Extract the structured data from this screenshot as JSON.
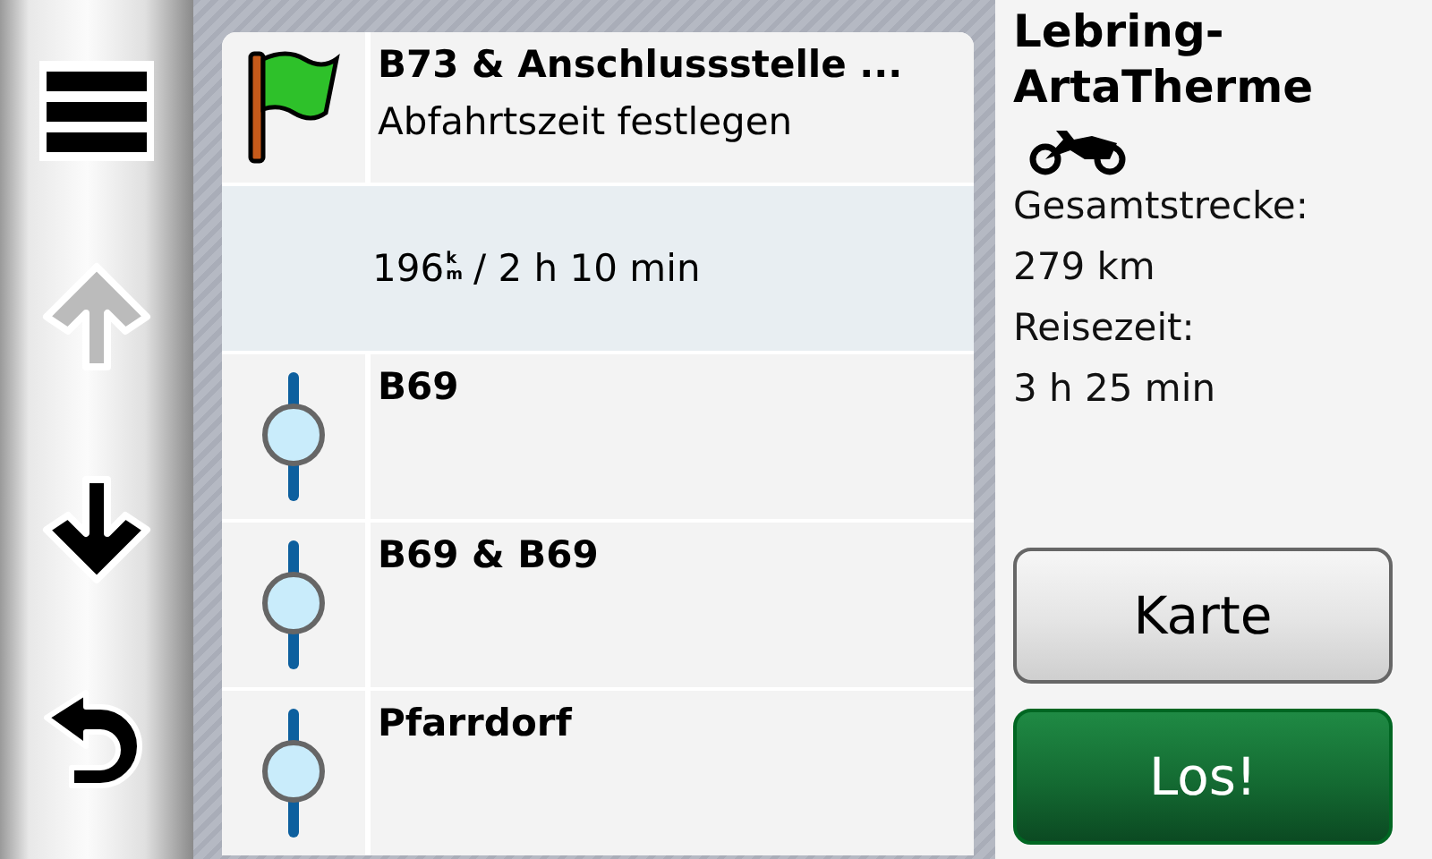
{
  "side_buttons": [
    {
      "kind": "menu",
      "disabled": false
    },
    {
      "kind": "up",
      "disabled": true
    },
    {
      "kind": "down",
      "disabled": false
    },
    {
      "kind": "back",
      "disabled": false
    }
  ],
  "route": [
    {
      "kind": "start",
      "title": "B73 & Anschlussstelle ...",
      "subtitle": "Abfahrtszeit festlegen"
    },
    {
      "kind": "summary",
      "distance": "196",
      "unit_top": "k",
      "unit_bottom": "m",
      "duration": "/ 2 h 10 min"
    },
    {
      "kind": "waypoint",
      "title": "B69"
    },
    {
      "kind": "waypoint",
      "title": "B69 & B69"
    },
    {
      "kind": "waypoint",
      "title": "Pfarrdorf"
    }
  ],
  "destination": {
    "title": "Lebring-ArtaTherme",
    "total_label": "Gesamtstrecke:",
    "total": "279 km",
    "time_label": "Reisezeit:",
    "time": "3 h 25 min"
  },
  "buttons": [
    {
      "kind": "secondary",
      "label": "Karte"
    },
    {
      "kind": "primary",
      "label": "Los!"
    }
  ]
}
